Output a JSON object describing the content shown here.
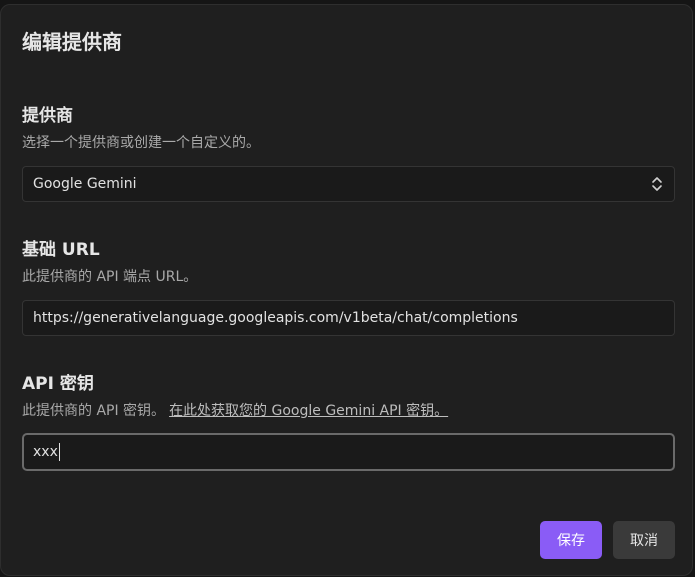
{
  "dialog": {
    "title": "编辑提供商"
  },
  "provider": {
    "label": "提供商",
    "description": "选择一个提供商或创建一个自定义的。",
    "selected": "Google Gemini"
  },
  "base_url": {
    "label": "基础 URL",
    "description": "此提供商的 API 端点 URL。",
    "value": "https://generativelanguage.googleapis.com/v1beta/chat/completions"
  },
  "api_key": {
    "label": "API 密钥",
    "description": "此提供商的 API 密钥。",
    "link_text": "在此处获取您的 Google Gemini API 密钥。",
    "value": "xxx"
  },
  "actions": {
    "save_label": "保存",
    "cancel_label": "取消"
  },
  "colors": {
    "accent": "#8a5cf6",
    "dialog_bg": "#1f1f1f"
  }
}
